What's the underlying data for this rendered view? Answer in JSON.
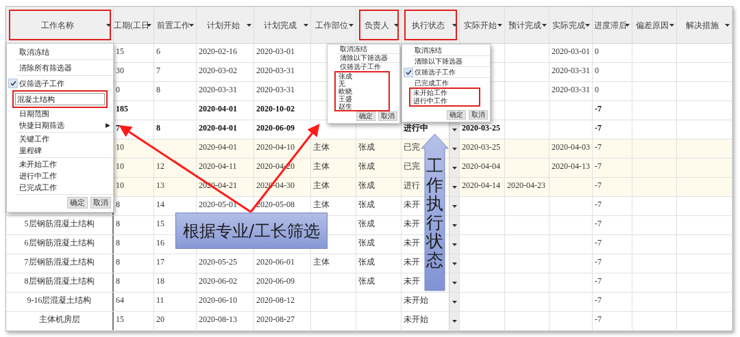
{
  "table": {
    "columns": [
      {
        "label": "工作名称",
        "highlighted": true
      },
      {
        "label": "工期(工日",
        "highlighted": false
      },
      {
        "label": "前置工作",
        "highlighted": false
      },
      {
        "label": "计划开始",
        "highlighted": false
      },
      {
        "label": "计划完成",
        "highlighted": false
      },
      {
        "label": "工作部位",
        "highlighted": false
      },
      {
        "label": "负责人",
        "highlighted": true
      },
      {
        "label": "执行状态",
        "highlighted": true
      },
      {
        "label": "实际开始",
        "highlighted": false
      },
      {
        "label": "预计完成",
        "highlighted": false
      },
      {
        "label": "实际完成",
        "highlighted": false
      },
      {
        "label": "进度滞后",
        "highlighted": false
      },
      {
        "label": "偏差原因",
        "highlighted": false
      },
      {
        "label": "解决措施",
        "highlighted": false
      }
    ],
    "rows": [
      {
        "bold": false,
        "shaded": false,
        "duration": "15",
        "predecessor": "6",
        "plan_start": "2020-02-16",
        "plan_finish": "2020-03-01",
        "actual_finish": "2020-03-01",
        "delay": "0"
      },
      {
        "bold": false,
        "shaded": false,
        "duration": "30",
        "predecessor": "7",
        "plan_start": "2020-03-02",
        "plan_finish": "2020-03-31",
        "actual_finish": "2020-03-31",
        "delay": "0"
      },
      {
        "bold": false,
        "shaded": false,
        "duration": "0",
        "predecessor": "8",
        "plan_start": "2020-03-31",
        "plan_finish": "2020-03-31",
        "actual_finish": "2020-03-31",
        "delay": "0"
      },
      {
        "bold": true,
        "shaded": false,
        "duration": "185",
        "plan_start": "2020-04-01",
        "plan_finish": "2020-10-02",
        "delay": "-7"
      },
      {
        "bold": true,
        "shaded": false,
        "duration": "7",
        "predecessor": "8",
        "plan_start": "2020-04-01",
        "plan_finish": "2020-06-09",
        "status": "进行中",
        "actual_start": "2020-03-25",
        "delay": "-7"
      },
      {
        "bold": false,
        "shaded": true,
        "duration": "10",
        "plan_start": "2020-04-01",
        "plan_finish": "2020-04-10",
        "location": "主体",
        "owner": "张成",
        "status": "已完",
        "actual_start": "2020-03-25",
        "actual_finish": "2020-04-03",
        "delay": "-7"
      },
      {
        "bold": false,
        "shaded": true,
        "duration": "10",
        "predecessor": "12",
        "plan_start": "2020-04-11",
        "plan_finish": "2020-04-20",
        "location": "主体",
        "owner": "张成",
        "status": "已完",
        "actual_start": "2020-04-04",
        "actual_finish": "2020-04-13",
        "delay": "-7"
      },
      {
        "bold": false,
        "shaded": true,
        "duration": "10",
        "predecessor": "13",
        "plan_start": "2020-04-21",
        "plan_finish": "2020-04-30",
        "location": "主体",
        "owner": "张成",
        "status": "进行",
        "actual_start": "2020-04-14",
        "expected_finish": "2020-04-23",
        "delay": "-7"
      },
      {
        "bold": false,
        "shaded": false,
        "duration": "8",
        "predecessor": "14",
        "plan_start": "2020-05-01",
        "plan_finish": "2020-05-08",
        "location": "主体",
        "owner": "张成",
        "status": "未开",
        "delay": "-7"
      },
      {
        "bold": false,
        "shaded": false,
        "name": "5层钢筋混凝土结构",
        "duration": "8",
        "predecessor": "15",
        "owner": "张成",
        "status": "未开",
        "delay": "-7"
      },
      {
        "bold": false,
        "shaded": false,
        "name": "6层钢筋混凝土结构",
        "duration": "8",
        "predecessor": "16",
        "owner": "张成",
        "status": "未开",
        "delay": "-7"
      },
      {
        "bold": false,
        "shaded": false,
        "name": "7层钢筋混凝土结构",
        "duration": "8",
        "predecessor": "17",
        "plan_start": "2020-05-25",
        "plan_finish": "2020-06-01",
        "location": "主体",
        "owner": "张成",
        "status": "未开",
        "delay": "-7"
      },
      {
        "bold": false,
        "shaded": false,
        "name": "8层钢筋混凝土结构",
        "duration": "8",
        "predecessor": "18",
        "plan_start": "2020-06-02",
        "plan_finish": "2020-06-09",
        "owner": "张成",
        "status": "未开",
        "delay": "-7"
      },
      {
        "bold": false,
        "shaded": false,
        "name": "9-16层混凝土结构",
        "duration": "64",
        "predecessor": "11",
        "plan_start": "2020-06-10",
        "plan_finish": "2020-08-12",
        "status": "未开始",
        "delay": "-7"
      },
      {
        "bold": false,
        "shaded": false,
        "name": "主体机房层",
        "duration": "15",
        "predecessor": "20",
        "plan_start": "2020-08-13",
        "plan_finish": "2020-08-27",
        "status": "未开始",
        "delay": "-7"
      }
    ]
  },
  "menus": [
    {
      "items": [
        {
          "kind": "action",
          "label": "取消冻结"
        },
        {
          "kind": "separator"
        },
        {
          "kind": "action",
          "label": "清除所有筛选器"
        },
        {
          "kind": "separator"
        },
        {
          "kind": "check",
          "label": "仅筛选子工作",
          "checked": true
        },
        {
          "kind": "input",
          "value": "混凝土结构",
          "highlighted": true
        },
        {
          "kind": "action",
          "label": "日期范围"
        },
        {
          "kind": "submenu",
          "label": "快捷日期筛选",
          "arrow": "▶"
        },
        {
          "kind": "separator"
        },
        {
          "kind": "action",
          "label": "关键工作"
        },
        {
          "kind": "action",
          "label": "里程碑"
        },
        {
          "kind": "separator"
        },
        {
          "kind": "action",
          "label": "未开始工作"
        },
        {
          "kind": "action",
          "label": "进行中工作"
        },
        {
          "kind": "action",
          "label": "已完成工作"
        },
        {
          "kind": "separator"
        }
      ],
      "buttons": [
        "确定",
        "取消"
      ]
    },
    {
      "items": [
        {
          "kind": "action",
          "label": "取消冻结"
        },
        {
          "kind": "separator"
        },
        {
          "kind": "action",
          "label": "清除以下筛选器"
        },
        {
          "kind": "separator"
        },
        {
          "kind": "check",
          "label": "仅筛选子工作",
          "checked": false
        },
        {
          "kind": "group",
          "highlighted": true,
          "items": [
            {
              "kind": "action",
              "label": "张成"
            },
            {
              "kind": "action",
              "label": "无"
            },
            {
              "kind": "action",
              "label": "欧晓"
            },
            {
              "kind": "action",
              "label": "王盛"
            },
            {
              "kind": "action",
              "label": "赵生"
            }
          ]
        }
      ],
      "buttons": [
        "确定",
        "取消"
      ]
    },
    {
      "items": [
        {
          "kind": "action",
          "label": "取消冻结"
        },
        {
          "kind": "separator"
        },
        {
          "kind": "action",
          "label": "清除以下筛选器"
        },
        {
          "kind": "separator"
        },
        {
          "kind": "check",
          "label": "仅筛选子工作",
          "checked": true
        },
        {
          "kind": "separator"
        },
        {
          "kind": "action",
          "label": "已完成工作"
        },
        {
          "kind": "group",
          "highlighted": true,
          "items": [
            {
              "kind": "action",
              "label": "未开始工作"
            },
            {
              "kind": "action",
              "label": "进行中工作"
            }
          ]
        }
      ],
      "buttons": [
        "确定",
        "取消"
      ]
    }
  ],
  "callouts": [
    {
      "kind": "box",
      "text": "根据专业/工长筛选"
    },
    {
      "kind": "up_arrow",
      "text": "工作执行状态"
    }
  ]
}
